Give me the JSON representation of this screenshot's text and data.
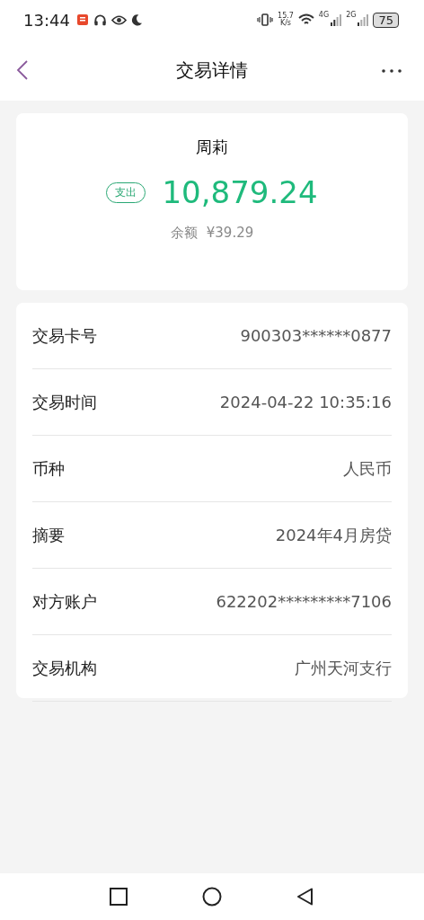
{
  "status_bar": {
    "time": "13:44",
    "speed": "15.7",
    "speed_unit": "K/s",
    "network_1": "4G",
    "network_2": "2G",
    "battery": "75"
  },
  "header": {
    "title": "交易详情"
  },
  "summary": {
    "name": "周莉",
    "badge": "支出",
    "amount": "10,879.24",
    "balance_label": "余额",
    "balance": "¥39.29"
  },
  "details": [
    {
      "label": "交易卡号",
      "value": "900303******0877"
    },
    {
      "label": "交易时间",
      "value": "2024-04-22 10:35:16"
    },
    {
      "label": "币种",
      "value": "人民币"
    },
    {
      "label": "摘要",
      "value": "2024年4月房贷"
    },
    {
      "label": "对方账户",
      "value": "622202*********7106"
    },
    {
      "label": "交易机构",
      "value": "广州天河支行"
    }
  ]
}
